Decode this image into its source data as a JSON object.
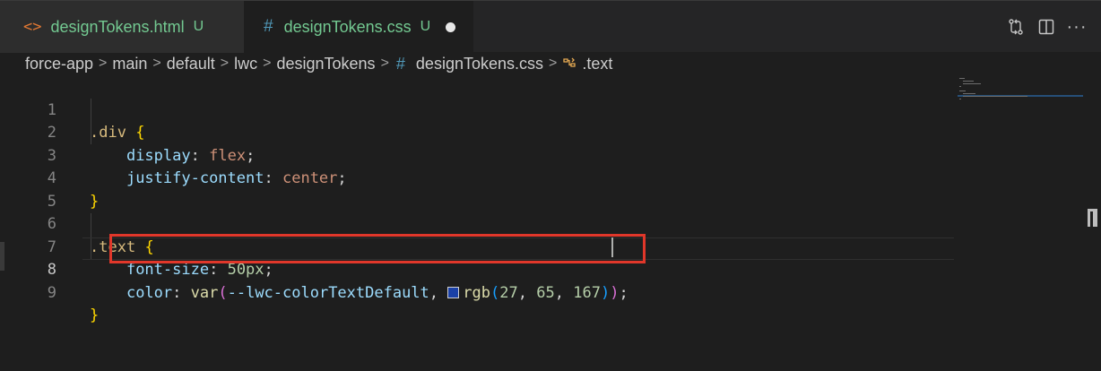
{
  "tabs": [
    {
      "icon": "<>",
      "name": "designTokens.html",
      "status": "U"
    },
    {
      "icon": "#",
      "name": "designTokens.css",
      "status": "U"
    }
  ],
  "breadcrumb": {
    "items": [
      "force-app",
      "main",
      "default",
      "lwc",
      "designTokens",
      "designTokens.css",
      ".text"
    ],
    "separator": ">",
    "file_icon": "#"
  },
  "editor": {
    "line_numbers": [
      "1",
      "2",
      "3",
      "4",
      "5",
      "6",
      "7",
      "8",
      "9"
    ],
    "active_line": "8",
    "lines": {
      "l1_sel": ".div",
      "l1_brace": "{",
      "l2_prop": "display",
      "l2_colon": ":",
      "l2_val": "flex",
      "l2_semi": ";",
      "l3_prop": "justify-content",
      "l3_colon": ":",
      "l3_val": "center",
      "l3_semi": ";",
      "l4_brace": "}",
      "l6_sel": ".text",
      "l6_brace": "{",
      "l7_prop": "font-size",
      "l7_colon": ":",
      "l7_num": "50px",
      "l7_semi": ";",
      "l8_prop": "color",
      "l8_colon": ":",
      "l8_fn": "var",
      "l8_open": "(",
      "l8_var": "--lwc-colorTextDefault",
      "l8_comma": ",",
      "l8_rgb": "rgb",
      "l8_open2": "(",
      "l8_r": "27",
      "l8_c1": ",",
      "l8_g": "65",
      "l8_c2": ",",
      "l8_b": "167",
      "l8_close2": ")",
      "l8_close": ")",
      "l8_semi": ";",
      "l9_brace": "}"
    },
    "swatch_color": "#1b41a7"
  },
  "colors": {
    "untracked": "#73c991",
    "html_icon": "#e37933",
    "css_icon": "#519aba",
    "highlight_box": "#e1372a"
  },
  "icons": {
    "compare": "compare-changes-icon",
    "split": "split-editor-icon",
    "more": "more-actions-icon",
    "symbol": "symbol-class-icon"
  },
  "more_label": "···"
}
